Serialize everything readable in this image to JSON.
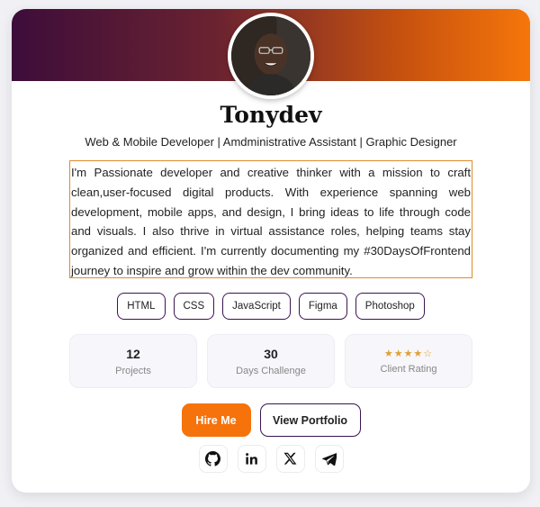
{
  "profile": {
    "name": "Tonydev",
    "role": "Web & Mobile Developer | Amdministrative Assistant | Graphic Designer",
    "bio": "I'm Passionate developer and creative thinker with a mission to craft clean,user-focused digital products. With experience spanning web development, mobile apps, and design, I bring ideas to life through code and visuals. I also thrive in virtual assistance roles, helping teams stay organized and efficient. I'm currently documenting my #30DaysOfFrontend journey to inspire and grow within the dev community."
  },
  "skills": [
    "HTML",
    "CSS",
    "JavaScript",
    "Figma",
    "Photoshop"
  ],
  "stats": [
    {
      "value": "12",
      "label": "Projects"
    },
    {
      "value": "30",
      "label": "Days Challenge"
    },
    {
      "stars": "★★★★☆",
      "rating": 4,
      "label": "Client Rating"
    }
  ],
  "actions": {
    "hire_label": "Hire Me",
    "portfolio_label": "View Portfolio"
  },
  "socials": [
    "github-icon",
    "linkedin-icon",
    "x-icon",
    "telegram-icon"
  ],
  "colors": {
    "accent": "#f6720b",
    "brand_dark": "#3b1452",
    "banner_start": "#3d0d3a",
    "banner_end": "#f5760a"
  }
}
